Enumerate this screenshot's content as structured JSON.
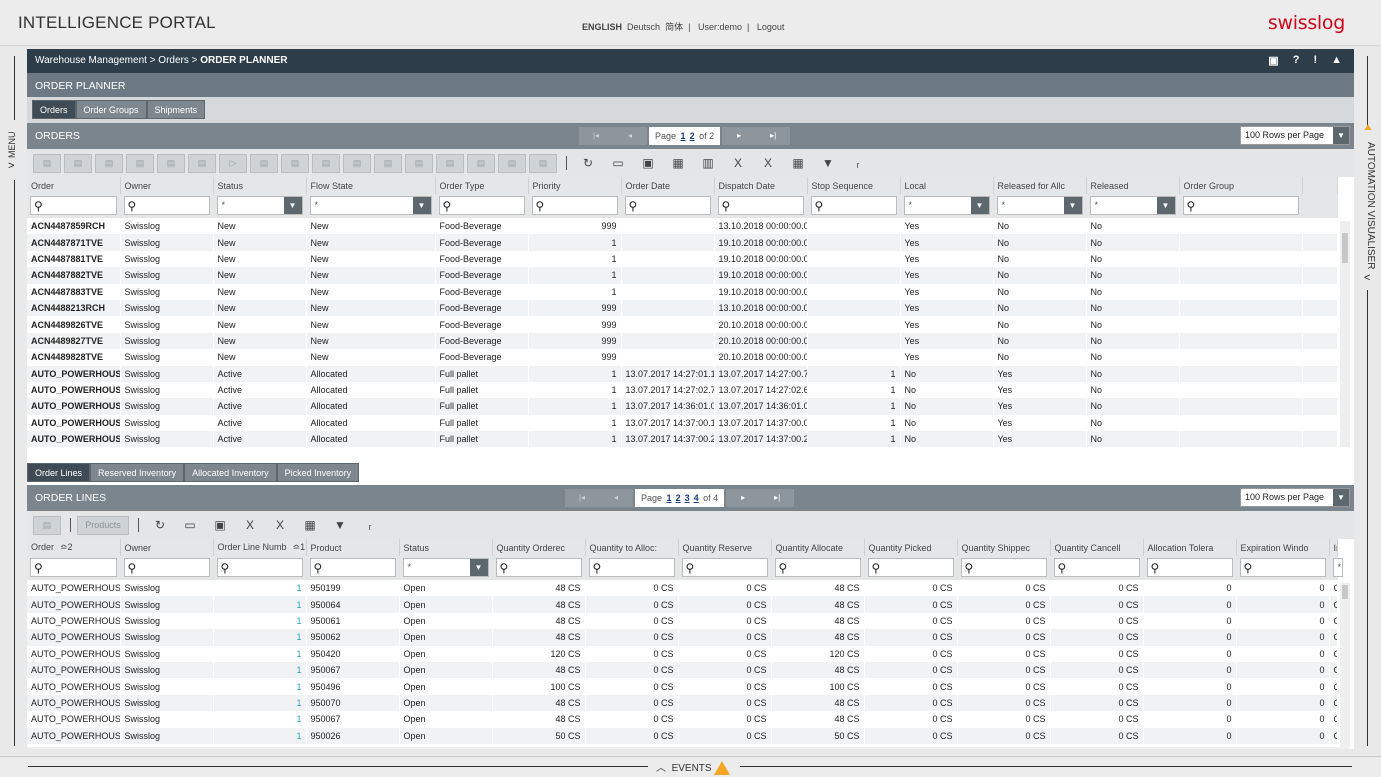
{
  "app": {
    "title": "INTELLIGENCE PORTAL",
    "logo": "swisslog"
  },
  "lang": {
    "english": "ENGLISH",
    "deutsch": "Deutsch",
    "chinese": "简体",
    "user": "User:demo",
    "logout": "Logout",
    "sep": "|"
  },
  "rails": {
    "menu": "MENU",
    "automation": "AUTOMATION VISUALISER",
    "events": "EVENTS"
  },
  "breadcrumb": {
    "path": "Warehouse Management > Orders > ",
    "current": "ORDER PLANNER"
  },
  "section_title": "ORDER PLANNER",
  "tabs": [
    "Orders",
    "Order Groups",
    "Shipments"
  ],
  "orders": {
    "title": "ORDERS",
    "pager": {
      "label": "Page",
      "p1": "1",
      "p2": "2",
      "of": "of 2"
    },
    "rpp": "100 Rows per Page",
    "columns": [
      "Order",
      "Owner",
      "Status",
      "Flow State",
      "Order Type",
      "Priority",
      "Order Date",
      "Dispatch Date",
      "Stop Sequence",
      "Local",
      "Released for Allc",
      "Released",
      "Order Group"
    ],
    "filter_star": "*",
    "rows": [
      [
        "ACN4487859RCH",
        "Swisslog",
        "New",
        "New",
        "Food-Beverage",
        "999",
        "",
        "13.10.2018 00:00:00.0",
        "",
        "Yes",
        "No",
        "No"
      ],
      [
        "ACN4487871TVE",
        "Swisslog",
        "New",
        "New",
        "Food-Beverage",
        "1",
        "",
        "19.10.2018 00:00:00.0",
        "",
        "Yes",
        "No",
        "No"
      ],
      [
        "ACN4487881TVE",
        "Swisslog",
        "New",
        "New",
        "Food-Beverage",
        "1",
        "",
        "19.10.2018 00:00:00.0",
        "",
        "Yes",
        "No",
        "No"
      ],
      [
        "ACN4487882TVE",
        "Swisslog",
        "New",
        "New",
        "Food-Beverage",
        "1",
        "",
        "19.10.2018 00:00:00.0",
        "",
        "Yes",
        "No",
        "No"
      ],
      [
        "ACN4487883TVE",
        "Swisslog",
        "New",
        "New",
        "Food-Beverage",
        "1",
        "",
        "19.10.2018 00:00:00.0",
        "",
        "Yes",
        "No",
        "No"
      ],
      [
        "ACN4488213RCH",
        "Swisslog",
        "New",
        "New",
        "Food-Beverage",
        "999",
        "",
        "13.10.2018 00:00:00.0",
        "",
        "Yes",
        "No",
        "No"
      ],
      [
        "ACN4489826TVE",
        "Swisslog",
        "New",
        "New",
        "Food-Beverage",
        "999",
        "",
        "20.10.2018 00:00:00.0",
        "",
        "Yes",
        "No",
        "No"
      ],
      [
        "ACN4489827TVE",
        "Swisslog",
        "New",
        "New",
        "Food-Beverage",
        "999",
        "",
        "20.10.2018 00:00:00.0",
        "",
        "Yes",
        "No",
        "No"
      ],
      [
        "ACN4489828TVE",
        "Swisslog",
        "New",
        "New",
        "Food-Beverage",
        "999",
        "",
        "20.10.2018 00:00:00.0",
        "",
        "Yes",
        "No",
        "No"
      ],
      [
        "AUTO_POWERHOUSI",
        "Swisslog",
        "Active",
        "Allocated",
        "Full pallet",
        "1",
        "13.07.2017 14:27:01.1",
        "13.07.2017 14:27:00.7",
        "1",
        "No",
        "Yes",
        "No"
      ],
      [
        "AUTO_POWERHOUSI",
        "Swisslog",
        "Active",
        "Allocated",
        "Full pallet",
        "1",
        "13.07.2017 14:27:02.7",
        "13.07.2017 14:27:02.6",
        "1",
        "No",
        "Yes",
        "No"
      ],
      [
        "AUTO_POWERHOUSI",
        "Swisslog",
        "Active",
        "Allocated",
        "Full pallet",
        "1",
        "13.07.2017 14:36:01.0",
        "13.07.2017 14:36:01.0",
        "1",
        "No",
        "Yes",
        "No"
      ],
      [
        "AUTO_POWERHOUSI",
        "Swisslog",
        "Active",
        "Allocated",
        "Full pallet",
        "1",
        "13.07.2017 14:37:00.1",
        "13.07.2017 14:37:00.0",
        "1",
        "No",
        "Yes",
        "No"
      ],
      [
        "AUTO_POWERHOUSI",
        "Swisslog",
        "Active",
        "Allocated",
        "Full pallet",
        "1",
        "13.07.2017 14:37:00.2",
        "13.07.2017 14:37:00.2",
        "1",
        "No",
        "Yes",
        "No"
      ]
    ]
  },
  "lower_tabs": [
    "Order Lines",
    "Reserved Inventory",
    "Allocated Inventory",
    "Picked Inventory"
  ],
  "lines": {
    "title": "ORDER LINES",
    "pager": {
      "label": "Page",
      "p1": "1",
      "p2": "2",
      "p3": "3",
      "p4": "4",
      "of": "of 4"
    },
    "rpp": "100 Rows per Page",
    "products_btn": "Products",
    "columns": [
      "Order",
      "Owner",
      "Order Line Numb",
      "Product",
      "Status",
      "Quantity Orderec",
      "Quantity to Alloc:",
      "Quantity Reserve",
      "Quantity Allocate",
      "Quantity Picked",
      "Quantity Shippec",
      "Quantity Cancell",
      "Allocation Tolera",
      "Expiration Windo",
      "Inv"
    ],
    "sort_marks": {
      "order": "2",
      "line": "1"
    },
    "filter_star": "*",
    "rows": [
      [
        "AUTO_POWERHOUSE",
        "Swisslog",
        "1",
        "950199",
        "Open",
        "48 CS",
        "0 CS",
        "0 CS",
        "48 CS",
        "0 CS",
        "0 CS",
        "0 CS",
        "0",
        "0",
        "C"
      ],
      [
        "AUTO_POWERHOUSE",
        "Swisslog",
        "1",
        "950064",
        "Open",
        "48 CS",
        "0 CS",
        "0 CS",
        "48 CS",
        "0 CS",
        "0 CS",
        "0 CS",
        "0",
        "0",
        "C"
      ],
      [
        "AUTO_POWERHOUSE",
        "Swisslog",
        "1",
        "950061",
        "Open",
        "48 CS",
        "0 CS",
        "0 CS",
        "48 CS",
        "0 CS",
        "0 CS",
        "0 CS",
        "0",
        "0",
        "C"
      ],
      [
        "AUTO_POWERHOUSE",
        "Swisslog",
        "1",
        "950062",
        "Open",
        "48 CS",
        "0 CS",
        "0 CS",
        "48 CS",
        "0 CS",
        "0 CS",
        "0 CS",
        "0",
        "0",
        "C"
      ],
      [
        "AUTO_POWERHOUSE",
        "Swisslog",
        "1",
        "950420",
        "Open",
        "120 CS",
        "0 CS",
        "0 CS",
        "120 CS",
        "0 CS",
        "0 CS",
        "0 CS",
        "0",
        "0",
        "C"
      ],
      [
        "AUTO_POWERHOUSE",
        "Swisslog",
        "1",
        "950067",
        "Open",
        "48 CS",
        "0 CS",
        "0 CS",
        "48 CS",
        "0 CS",
        "0 CS",
        "0 CS",
        "0",
        "0",
        "C"
      ],
      [
        "AUTO_POWERHOUSE",
        "Swisslog",
        "1",
        "950496",
        "Open",
        "100 CS",
        "0 CS",
        "0 CS",
        "100 CS",
        "0 CS",
        "0 CS",
        "0 CS",
        "0",
        "0",
        "C"
      ],
      [
        "AUTO_POWERHOUSE",
        "Swisslog",
        "1",
        "950070",
        "Open",
        "48 CS",
        "0 CS",
        "0 CS",
        "48 CS",
        "0 CS",
        "0 CS",
        "0 CS",
        "0",
        "0",
        "C"
      ],
      [
        "AUTO_POWERHOUSE",
        "Swisslog",
        "1",
        "950067",
        "Open",
        "48 CS",
        "0 CS",
        "0 CS",
        "48 CS",
        "0 CS",
        "0 CS",
        "0 CS",
        "0",
        "0",
        "C"
      ],
      [
        "AUTO_POWERHOUSE",
        "Swisslog",
        "1",
        "950026",
        "Open",
        "50 CS",
        "0 CS",
        "0 CS",
        "50 CS",
        "0 CS",
        "0 CS",
        "0 CS",
        "0",
        "0",
        "C"
      ]
    ]
  },
  "colors": {
    "accent": "#2aa0c9",
    "header": "#2d3e4a",
    "warn": "#f5a623",
    "brand": "#d0021b"
  }
}
